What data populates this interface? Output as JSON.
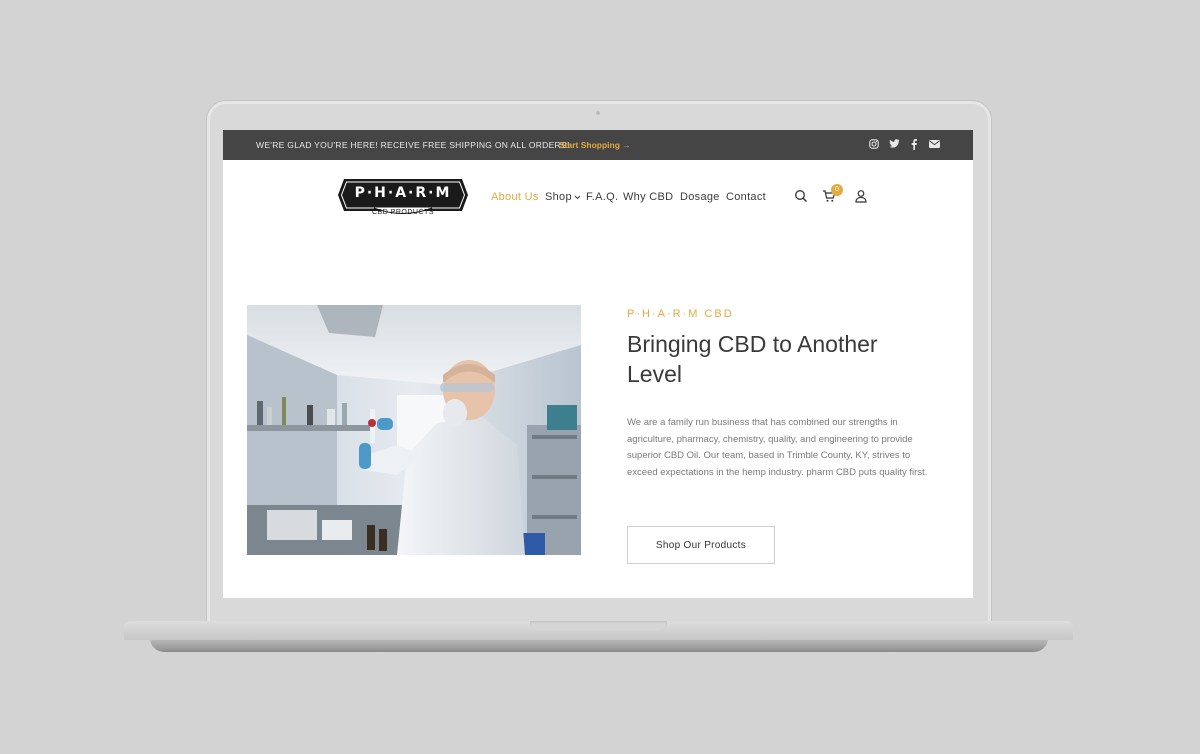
{
  "promo_bar": {
    "message": "WE'RE GLAD YOU'RE HERE! RECEIVE FREE SHIPPING ON ALL ORDERS!",
    "link": "Start Shopping →",
    "social_icons": [
      "instagram-icon",
      "twitter-icon",
      "facebook-icon",
      "email-icon"
    ]
  },
  "logo": {
    "wordmark": "P·H·A·R·M",
    "tagline": "CBD PRODUCTS"
  },
  "nav": {
    "items": [
      {
        "label": "About Us",
        "active": true
      },
      {
        "label": "Shop",
        "has_dropdown": true
      },
      {
        "label": "F.A.Q."
      },
      {
        "label": "Why CBD"
      },
      {
        "label": "Dosage"
      },
      {
        "label": "Contact"
      }
    ],
    "cart_count": "0",
    "icons": [
      "search-icon",
      "cart-icon",
      "account-icon"
    ]
  },
  "hero": {
    "eyebrow": "P·H·A·R·M CBD",
    "heading": "Bringing CBD to Another Level",
    "body": "We are a family run business that has combined our strengths in agriculture, pharmacy, chemistry, quality, and engineering to provide superior CBD Oil. Our team, based in Trimble County, KY, strives to exceed expectations in the hemp industry. pharm CBD puts quality first.",
    "cta_label": "Shop Our Products"
  },
  "colors": {
    "accent": "#e5a93f",
    "topbar": "#454545",
    "text": "#3a3a3a",
    "muted": "#7a7a7a",
    "page_background": "#d3d3d3"
  }
}
